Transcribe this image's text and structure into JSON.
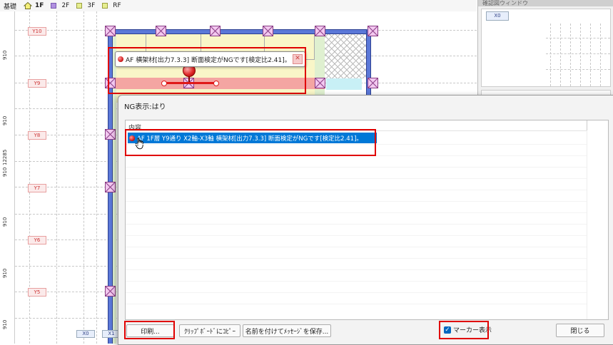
{
  "floor_tabs": [
    {
      "label": "基礎",
      "color": "#ffffff",
      "active": false
    },
    {
      "label": "1F",
      "color": "#f5f07a",
      "active": true
    },
    {
      "label": "2F",
      "color": "#b090e0",
      "active": false
    },
    {
      "label": "3F",
      "color": "#e6ee90",
      "active": false
    },
    {
      "label": "RF",
      "color": "#e6ee90",
      "active": false
    }
  ],
  "ruler": {
    "dims": [
      "910",
      "910",
      "12285",
      "910",
      "910",
      "910",
      "910"
    ]
  },
  "axes": {
    "y_labels": [
      "Y10",
      "Y9",
      "Y8",
      "Y7",
      "Y6",
      "Y5"
    ],
    "x_labels": [
      "X0",
      "X1"
    ]
  },
  "tooltip": {
    "text": "AF 横架材[出力7.3.3] 断面検定がNGです[検定比2.41]。"
  },
  "right_panel": {
    "title": "確認図ウィンドウ",
    "chip": "X0"
  },
  "dialog": {
    "title": "NG表示:はり",
    "column_header": "内容",
    "selected_item": "AF 1F層 Y9通り X2軸-X3軸 横架材[出力7.3.3] 断面検定がNGです[検定比2.41]。",
    "print_button": "印刷...",
    "copy_button": "ｸﾘｯﾌﾟﾎﾞｰﾄﾞにｺﾋﾟｰ",
    "save_button": "名前を付けてﾒｯｾｰｼﾞを保存...",
    "marker_checkbox_label": "マーカー表示",
    "marker_checked": true,
    "close_button": "閉じる"
  },
  "colors": {
    "ng_red": "#e00000",
    "selection_blue": "#0078d7",
    "beam_blue": "#5b78d8",
    "column_pink": "#f2c7ef",
    "room_yellow": "#f9f6c8",
    "room_green": "#dff0d0",
    "room_cyan": "#c8f0f6"
  }
}
